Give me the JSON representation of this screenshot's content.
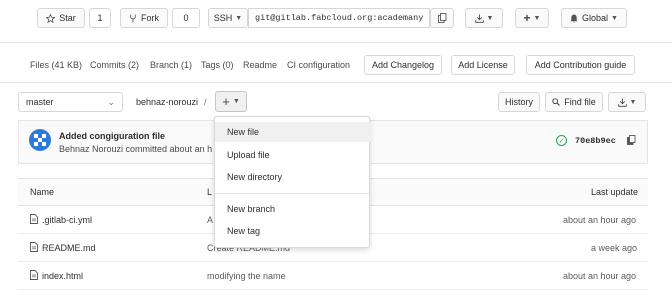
{
  "top_bar": {
    "star_label": "Star",
    "star_count": "1",
    "fork_label": "Fork",
    "fork_count": "0",
    "protocol": "SSH",
    "clone_url": "git@gitlab.fabcloud.org:academany",
    "global_label": "Global"
  },
  "stats_bar": {
    "files": "Files (41 KB)",
    "commits": "Commits (2)",
    "branch": "Branch (1)",
    "tags": "Tags (0)",
    "readme": "Readme",
    "ci_config": "CI configuration",
    "add_changelog": "Add Changelog",
    "add_license": "Add License",
    "add_contribution": "Add Contribution guide"
  },
  "nav_bar": {
    "branch_select": "master",
    "path_project": "behnaz-norouzi",
    "path_sep": "/",
    "history": "History",
    "find_file": "Find file"
  },
  "dropdown": {
    "items": [
      "New file",
      "Upload file",
      "New directory",
      "New branch",
      "New tag"
    ]
  },
  "commit": {
    "title": "Added congiguration file",
    "author_line": "Behnaz Norouzi committed about an h",
    "sha": "70e8b9ec"
  },
  "file_table": {
    "col_name": "Name",
    "col_last_commit": "L",
    "col_last_update": "Last update",
    "rows": [
      {
        "name": ".gitlab-ci.yml",
        "commit": "A",
        "updated": "about an hour ago"
      },
      {
        "name": "README.md",
        "commit": "Create README.md",
        "updated": "a week ago"
      },
      {
        "name": "index.html",
        "commit": "modifying the name",
        "updated": "about an hour ago"
      }
    ]
  },
  "colors": {
    "status_ok": "#1aaa55",
    "avatar_blue": "#2b7bd6",
    "hover_row": "#f0f0f0"
  }
}
